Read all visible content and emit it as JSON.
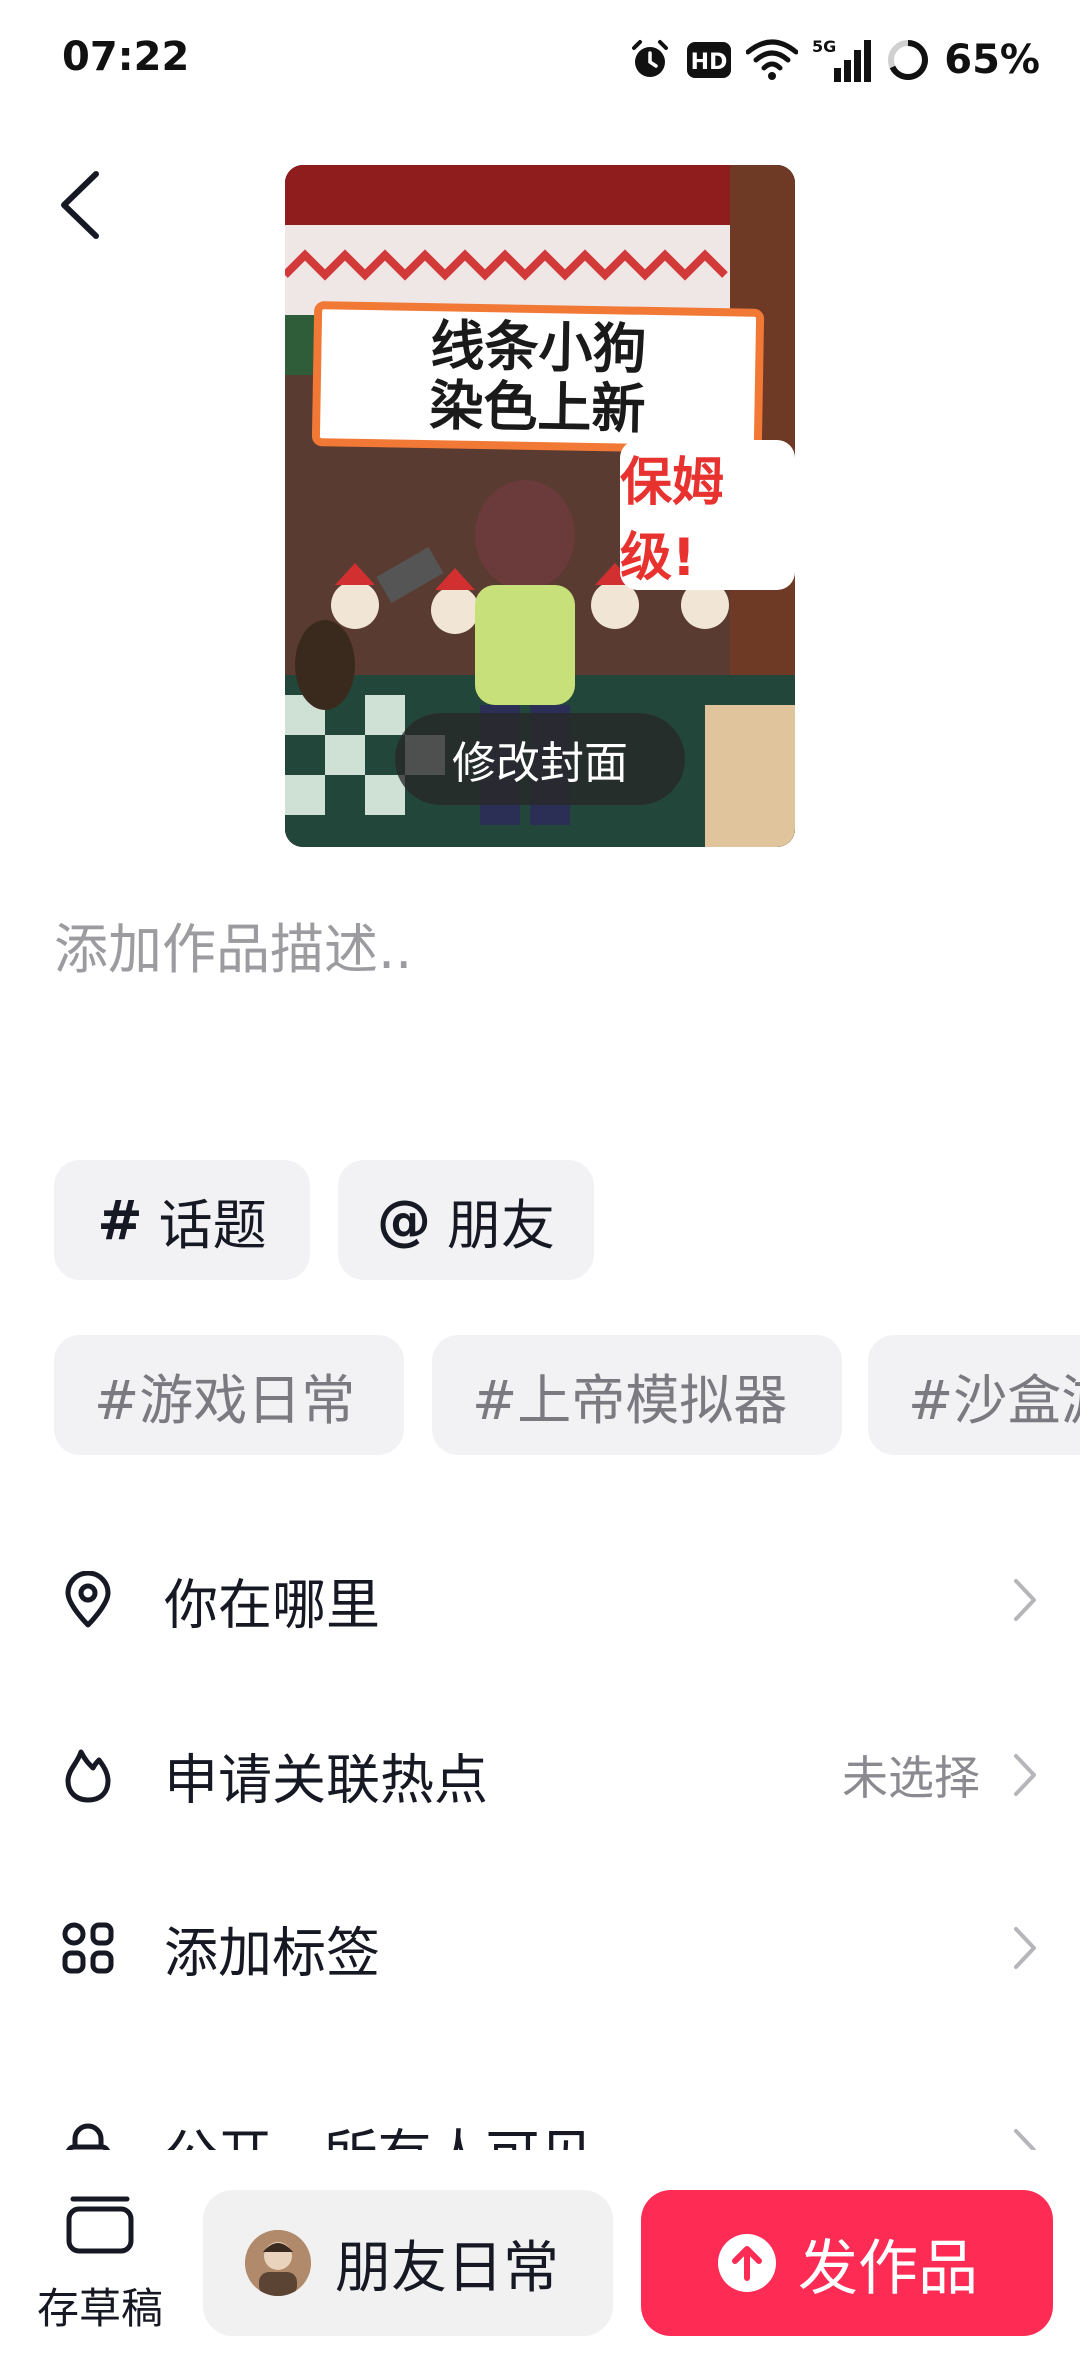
{
  "status_bar": {
    "time": "07:22",
    "icons": [
      "alarm-icon",
      "hd-icon",
      "wifi-icon",
      "5g-signal-icon",
      "battery-icon"
    ],
    "battery": "65%"
  },
  "cover": {
    "title_line1": "线条小狗",
    "title_line2": "染色上新",
    "badge": "保姆级!",
    "edit_label": "修改封面"
  },
  "description": {
    "placeholder": "添加作品描述.."
  },
  "chips": [
    {
      "symbol": "#",
      "label": "话题"
    },
    {
      "symbol": "@",
      "label": "朋友"
    }
  ],
  "suggested_tags": [
    "#游戏日常",
    "#上帝模拟器",
    "#沙盒游"
  ],
  "settings": [
    {
      "icon": "location-pin-icon",
      "label": "你在哪里",
      "value": ""
    },
    {
      "icon": "flame-icon",
      "label": "申请关联热点",
      "value": "未选择"
    },
    {
      "icon": "grid-icon",
      "label": "添加标签",
      "value": ""
    },
    {
      "icon": "lock-icon",
      "label": "公开 · 所有人可见",
      "value": ""
    }
  ],
  "bottom": {
    "draft_label": "存草稿",
    "circle_label": "朋友日常",
    "publish_label": "发作品"
  },
  "colors": {
    "accent": "#fe2c55",
    "chip_bg": "#f2f2f4"
  }
}
